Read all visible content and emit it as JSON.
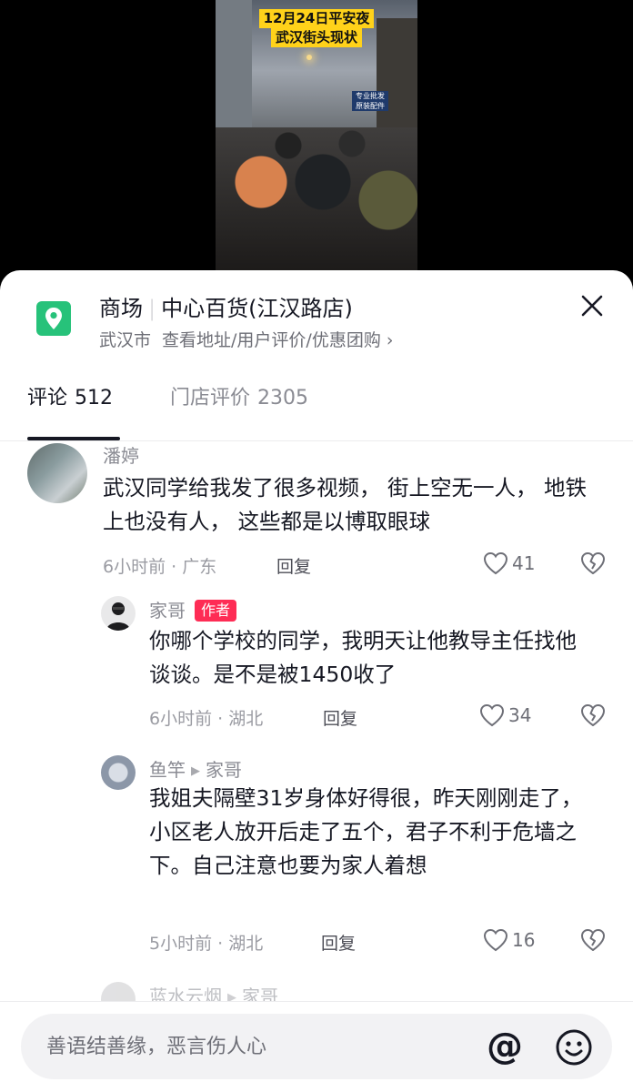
{
  "video": {
    "caption_line1": "12月24日平安夜",
    "caption_line2": "武汉街头现状",
    "shop_sign": "专业批发 原装配件"
  },
  "poi": {
    "icon": "location-pin-icon",
    "category": "商场",
    "name": "中心百货(江汉路店)",
    "city": "武汉市",
    "links": "查看地址/用户评价/优惠团购",
    "chevron": "›"
  },
  "tabs": [
    {
      "label": "评论",
      "count": "512",
      "active": true
    },
    {
      "label": "门店评价",
      "count": "2305",
      "active": false
    }
  ],
  "comments": [
    {
      "user": "潘婷",
      "text": "武汉同学给我发了很多视频， 街上空无一人， 地铁上也没有人， 这些都是以博取眼球",
      "time_location": "6小时前 · 广东",
      "reply_label": "回复",
      "likes": "41"
    },
    {
      "user": "家哥",
      "badge": "作者",
      "text": "你哪个学校的同学，我明天让他教导主任找他谈谈。是不是被1450收了",
      "time_location": "6小时前 · 湖北",
      "reply_label": "回复",
      "likes": "34"
    },
    {
      "user": "鱼竿",
      "reply_to": "家哥",
      "text": "我姐夫隔壁31岁身体好得很，昨天刚刚走了，小区老人放开后走了五个，君子不利于危墙之下。自己注意也要为家人着想",
      "time_location": "5小时前 · 湖北",
      "reply_label": "回复",
      "likes": "16"
    },
    {
      "user": "蓝水云烟",
      "reply_to": "家哥"
    }
  ],
  "input": {
    "placeholder": "善语结善缘，恶言伤人心",
    "at_symbol": "@"
  },
  "colors": {
    "accent": "#fe2c55",
    "pin_green": "#27c27a",
    "caption_yellow": "#ffd21a"
  }
}
